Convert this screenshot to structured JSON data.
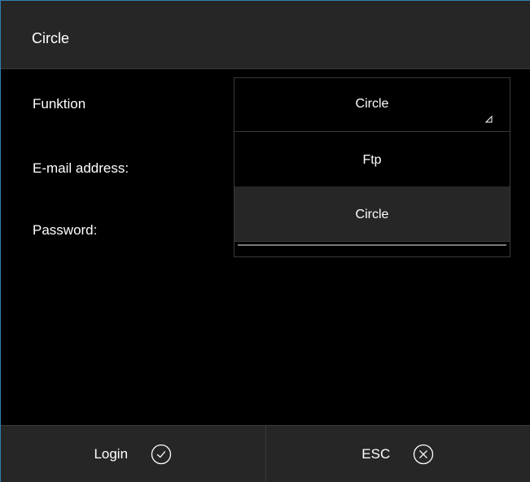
{
  "dialog": {
    "title": "Circle"
  },
  "form": {
    "function_label": "Funktion",
    "email_label": "E-mail address:",
    "password_label": "Password:"
  },
  "dropdown": {
    "selected_value": "Circle",
    "options": [
      {
        "label": "Ftp",
        "selected": false
      },
      {
        "label": "Circle",
        "selected": true
      }
    ],
    "caret_icon": "caret-corner-icon"
  },
  "footer": {
    "login_label": "Login",
    "login_icon": "check-circle-icon",
    "esc_label": "ESC",
    "esc_icon": "close-circle-icon"
  },
  "colors": {
    "background": "#000000",
    "panel": "#262626",
    "border": "#3a3a3a",
    "accent": "#2f7fb5",
    "text": "#ffffff"
  }
}
